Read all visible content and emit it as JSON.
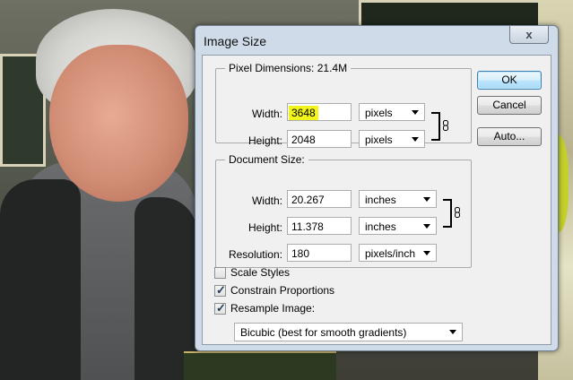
{
  "dialog": {
    "title": "Image Size",
    "close_glyph": "x",
    "pixel_dimensions": {
      "legend": "Pixel Dimensions:",
      "total": "21.4M",
      "width_label": "Width:",
      "width_value": "3648",
      "width_unit": "pixels",
      "height_label": "Height:",
      "height_value": "2048",
      "height_unit": "pixels"
    },
    "document_size": {
      "legend": "Document Size:",
      "width_label": "Width:",
      "width_value": "20.267",
      "width_unit": "inches",
      "height_label": "Height:",
      "height_value": "11.378",
      "height_unit": "inches",
      "resolution_label": "Resolution:",
      "resolution_value": "180",
      "resolution_unit": "pixels/inch"
    },
    "options": {
      "scale_styles": {
        "label": "Scale Styles",
        "checked": false
      },
      "constrain_proportions": {
        "label": "Constrain Proportions",
        "checked": true
      },
      "resample_image": {
        "label": "Resample Image:",
        "checked": true
      },
      "resample_method": "Bicubic (best for smooth gradients)"
    },
    "buttons": {
      "ok": "OK",
      "cancel": "Cancel",
      "auto": "Auto..."
    }
  },
  "icons": {
    "close": "close-icon",
    "link": "chain-link-icon",
    "dropdown": "chevron-down-icon",
    "check": "checkmark-icon"
  },
  "colors": {
    "highlight": "#f2f51c",
    "dialog_frame": "#cfdbe9",
    "default_button": "#bee6fd"
  }
}
